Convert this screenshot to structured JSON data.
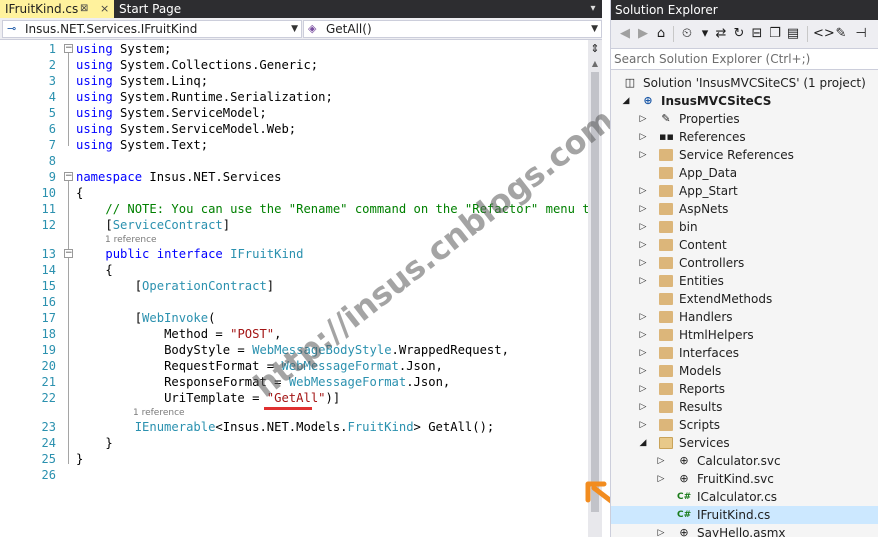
{
  "tabs": {
    "active": "IFruitKind.cs",
    "active_pin": "⊠",
    "active_close": "×",
    "start": "Start Page",
    "dropdown": "▾"
  },
  "nav": {
    "type_combo": "Insus.NET.Services.IFruitKind",
    "member_combo": "GetAll()"
  },
  "code_lines": [
    {
      "n": "1"
    },
    {
      "n": "2"
    },
    {
      "n": "3"
    },
    {
      "n": "4"
    },
    {
      "n": "5"
    },
    {
      "n": "6"
    },
    {
      "n": "7"
    },
    {
      "n": "8"
    },
    {
      "n": "9"
    },
    {
      "n": "10"
    },
    {
      "n": "11"
    },
    {
      "n": "12"
    },
    {
      "n": "13"
    },
    {
      "n": "14"
    },
    {
      "n": "15"
    },
    {
      "n": "16"
    },
    {
      "n": "17"
    },
    {
      "n": "18"
    },
    {
      "n": "19"
    },
    {
      "n": "20"
    },
    {
      "n": "21"
    },
    {
      "n": "22"
    },
    {
      "n": "23"
    },
    {
      "n": "24"
    },
    {
      "n": "25"
    },
    {
      "n": "26"
    }
  ],
  "code": {
    "using": "using",
    "ns_system": " System;",
    "ns_generic": " System.Collections.Generic;",
    "ns_linq": " System.Linq;",
    "ns_serialization": " System.Runtime.Serialization;",
    "ns_servicemodel": " System.ServiceModel;",
    "ns_servicemodel_web": " System.ServiceModel.Web;",
    "ns_text": " System.Text;",
    "namespace_kw": "namespace",
    "namespace_name": " Insus.NET.Services",
    "open_brace": "{",
    "close_brace": "}",
    "comment": "// NOTE: You can use the \"Rename\" command on the \"Refactor\" menu to c",
    "attr_open": "[",
    "service_contract": "ServiceContract",
    "attr_close": "]",
    "public_kw": "public",
    "interface_kw": " interface ",
    "interface_name": "IFruitKind",
    "operation_contract": "OperationContract",
    "webinvoke": "WebInvoke",
    "paren_open": "(",
    "method_lhs": "Method = ",
    "method_val": "\"POST\"",
    "comma": ",",
    "bodystyle_lhs": "BodyStyle = ",
    "bodystyle_type": "WebMessageBodyStyle",
    "bodystyle_rest": ".WrappedRequest,",
    "reqfmt_lhs": "RequestFormat = ",
    "msgfmt_type": "WebMessageFormat",
    "json_rest": ".Json,",
    "respfmt_lhs": "ResponseFormat = ",
    "uritemplate_lhs": "UriTemplate = ",
    "uritemplate_val": "\"GetAll\"",
    "attr_end": ")]",
    "ienumerable": "IEnumerable",
    "generic_open": "<Insus.NET.Models.",
    "fruitkind": "FruitKind",
    "method_sig": "> GetAll();",
    "reference_1": "1 reference",
    "reference_2": "1 reference"
  },
  "watermark": "http://insus.cnblogs.com",
  "colors": {
    "keyword": "#0000ff",
    "type": "#2b91af",
    "string": "#a31515",
    "comment": "#008000",
    "arrow": "#f28c1f",
    "underline": "#e03030"
  },
  "solution_explorer": {
    "title": "Solution Explorer",
    "search_placeholder": "Search Solution Explorer (Ctrl+;)",
    "toolbar_icons": [
      "back-icon",
      "forward-icon",
      "home-icon",
      "history-icon",
      "sync-icon",
      "refresh-icon",
      "collapse-icon",
      "copy-icon",
      "code-view-icon",
      "wrench-icon",
      "pin-icon"
    ],
    "nodes": [
      {
        "label": "Solution 'InsusMVCSiteCS' (1 project)"
      },
      {
        "label": "InsusMVCSiteCS"
      },
      {
        "label": "Properties"
      },
      {
        "label": "References"
      },
      {
        "label": "Service References"
      },
      {
        "label": "App_Data"
      },
      {
        "label": "App_Start"
      },
      {
        "label": "AspNets"
      },
      {
        "label": "bin"
      },
      {
        "label": "Content"
      },
      {
        "label": "Controllers"
      },
      {
        "label": "Entities"
      },
      {
        "label": "ExtendMethods"
      },
      {
        "label": "Handlers"
      },
      {
        "label": "HtmlHelpers"
      },
      {
        "label": "Interfaces"
      },
      {
        "label": "Models"
      },
      {
        "label": "Reports"
      },
      {
        "label": "Results"
      },
      {
        "label": "Scripts"
      },
      {
        "label": "Services"
      },
      {
        "label": "Calculator.svc"
      },
      {
        "label": "FruitKind.svc"
      },
      {
        "label": "ICalculator.cs"
      },
      {
        "label": "IFruitKind.cs"
      },
      {
        "label": "SayHello.asmx"
      }
    ]
  }
}
